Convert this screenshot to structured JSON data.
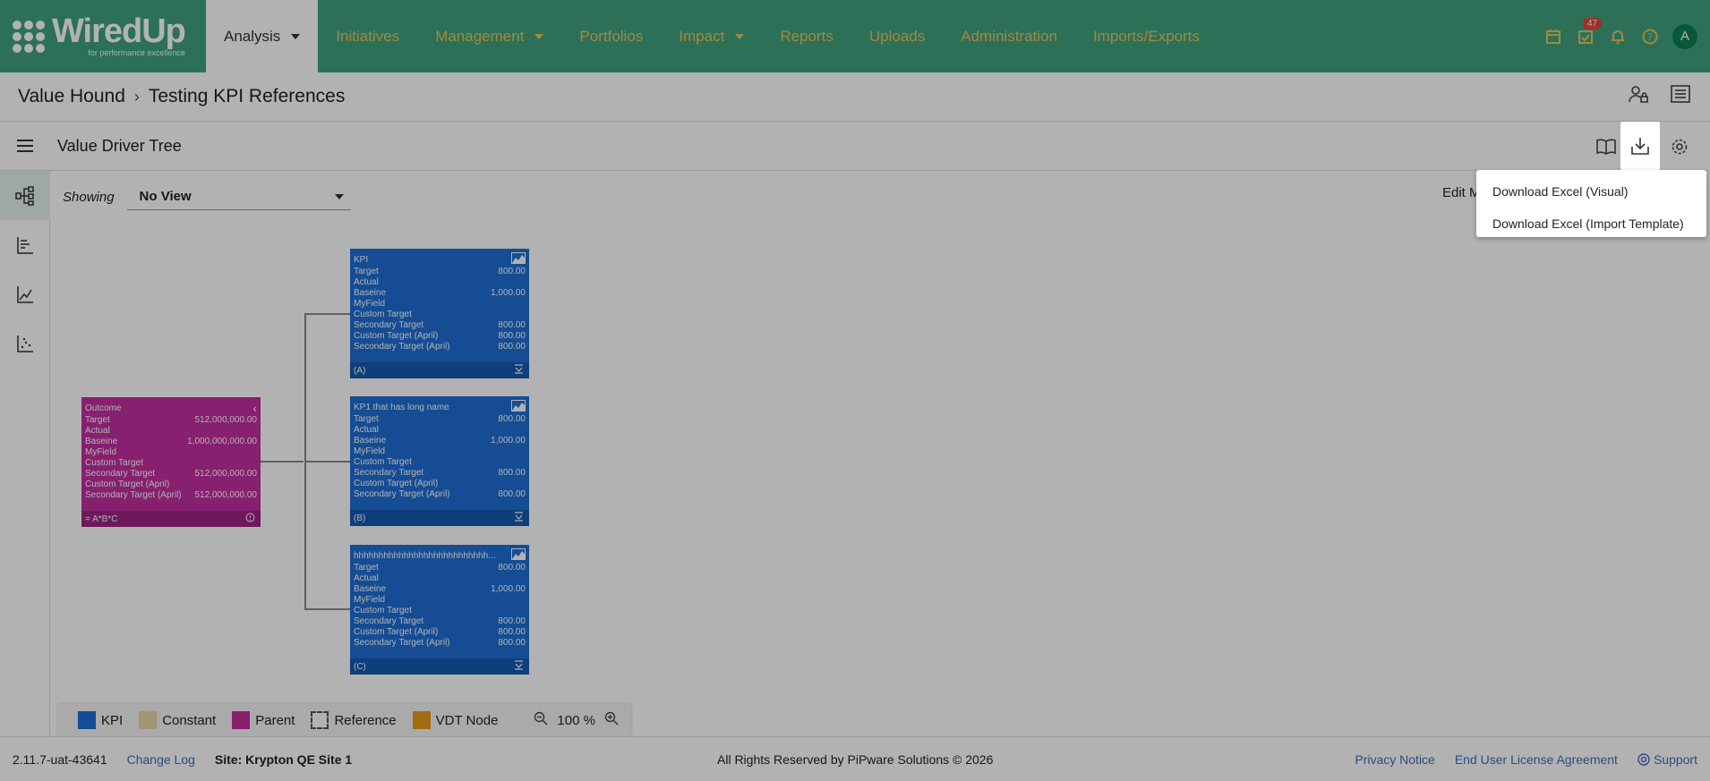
{
  "brand": {
    "name": "WiredUp",
    "tagline": "for performance excellence"
  },
  "nav": {
    "items": [
      {
        "label": "Analysis",
        "active": true,
        "dropdown": true
      },
      {
        "label": "Initiatives"
      },
      {
        "label": "Management",
        "dropdown": true
      },
      {
        "label": "Portfolios"
      },
      {
        "label": "Impact",
        "dropdown": true
      },
      {
        "label": "Reports"
      },
      {
        "label": "Uploads"
      },
      {
        "label": "Administration"
      },
      {
        "label": "Imports/Exports"
      }
    ],
    "task_badge": "47",
    "avatar": "A"
  },
  "breadcrumb": {
    "root": "Value Hound",
    "current": "Testing KPI References"
  },
  "toolbar": {
    "title": "Value Driver Tree"
  },
  "view": {
    "showing_label": "Showing",
    "selected": "No View",
    "edit_mode_partial": "Edit M"
  },
  "tree": {
    "outcome": {
      "title": "Outcome",
      "rows": [
        {
          "label": "Target",
          "value": "512,000,000.00"
        },
        {
          "label": "Actual",
          "value": ""
        },
        {
          "label": "Baseine",
          "value": "1,000,000,000.00"
        },
        {
          "label": "MyField",
          "value": ""
        },
        {
          "label": "Custom Target",
          "value": ""
        },
        {
          "label": "Secondary Target",
          "value": "512,000,000.00"
        },
        {
          "label": "Custom Target (April)",
          "value": ""
        },
        {
          "label": "Secondary Target (April)",
          "value": "512,000,000.00"
        }
      ],
      "formula": "= A*B*C"
    },
    "kpis": [
      {
        "title": "KPI",
        "rows": [
          {
            "label": "Target",
            "value": "800.00"
          },
          {
            "label": "Actual",
            "value": ""
          },
          {
            "label": "Baseine",
            "value": "1,000.00"
          },
          {
            "label": "MyField",
            "value": ""
          },
          {
            "label": "Custom Target",
            "value": ""
          },
          {
            "label": "Secondary Target",
            "value": "800.00"
          },
          {
            "label": "Custom Target (April)",
            "value": "800.00"
          },
          {
            "label": "Secondary Target (April)",
            "value": "800.00"
          }
        ],
        "ref": "(A)"
      },
      {
        "title": "KP1 that has long name",
        "rows": [
          {
            "label": "Target",
            "value": "800.00"
          },
          {
            "label": "Actual",
            "value": ""
          },
          {
            "label": "Baseine",
            "value": "1,000.00"
          },
          {
            "label": "MyField",
            "value": ""
          },
          {
            "label": "Custom Target",
            "value": ""
          },
          {
            "label": "Secondary Target",
            "value": "800.00"
          },
          {
            "label": "Custom Target (April)",
            "value": ""
          },
          {
            "label": "Secondary Target (April)",
            "value": "800.00"
          }
        ],
        "ref": "(B)"
      },
      {
        "title": "hhhhhhhhhhhhhhhhhhhhhhhhhhh...",
        "rows": [
          {
            "label": "Target",
            "value": "800.00"
          },
          {
            "label": "Actual",
            "value": ""
          },
          {
            "label": "Baseine",
            "value": "1,000.00"
          },
          {
            "label": "MyField",
            "value": ""
          },
          {
            "label": "Custom Target",
            "value": ""
          },
          {
            "label": "Secondary Target",
            "value": "800.00"
          },
          {
            "label": "Custom Target (April)",
            "value": "800.00"
          },
          {
            "label": "Secondary Target (April)",
            "value": "800.00"
          }
        ],
        "ref": "(C)"
      }
    ]
  },
  "legend": {
    "items": [
      {
        "label": "KPI",
        "color": "#1f6ed4"
      },
      {
        "label": "Constant",
        "color": "#e8d6a6"
      },
      {
        "label": "Parent",
        "color": "#c12fa0"
      },
      {
        "label": "Reference",
        "color": "dashed"
      },
      {
        "label": "VDT Node",
        "color": "#e89a16"
      }
    ],
    "zoom": "100 %"
  },
  "footer": {
    "version": "2.11.7-uat-43641",
    "changelog": "Change Log",
    "site": "Site: Krypton QE Site 1",
    "copyright": "All Rights Reserved by PiPware Solutions © 2026",
    "privacy": "Privacy Notice",
    "eula": "End User License Agreement",
    "support": "Support"
  },
  "download_menu": {
    "options": [
      "Download Excel (Visual)",
      "Download Excel (Import Template)"
    ]
  },
  "colors": {
    "nav_bg": "#3fa27d",
    "nav_text": "#e8c35c",
    "kpi": "#1f6ed4",
    "parent": "#c12fa0",
    "link": "#3a6fbf"
  }
}
